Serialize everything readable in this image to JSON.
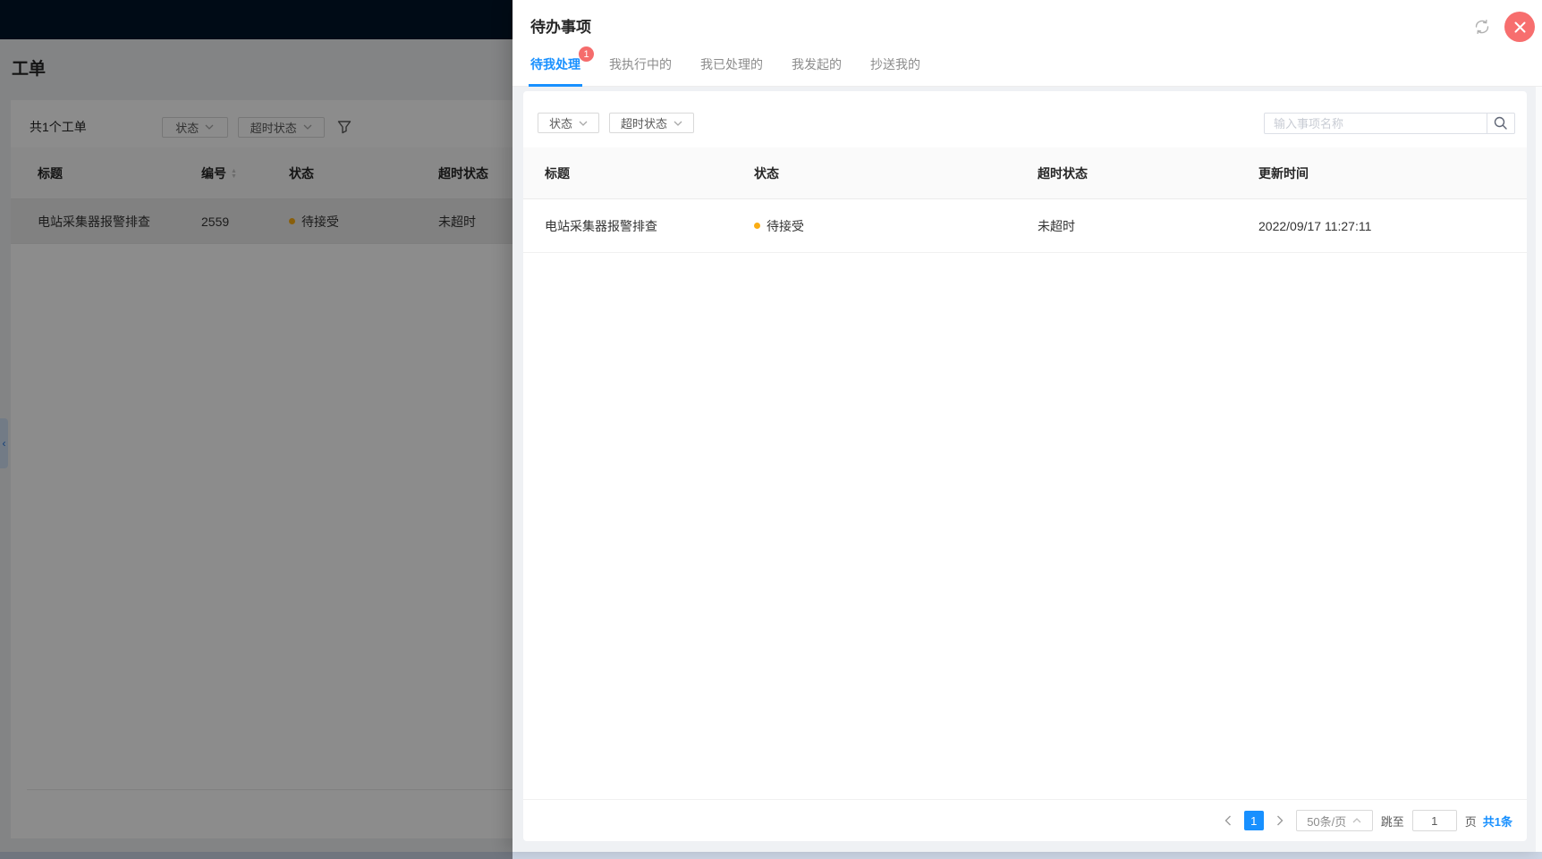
{
  "colors": {
    "accent": "#1890ff",
    "badge": "#f56c6c",
    "close_button": "#f76e6e",
    "status_dot": "#faad14",
    "topbar": "#001529"
  },
  "background": {
    "page_title": "工单",
    "toolbar": {
      "count": "共1个工单",
      "status_filter": "状态",
      "timeout_filter": "超时状态"
    },
    "table": {
      "headers": [
        "标题",
        "编号",
        "状态",
        "超时状态"
      ],
      "row": {
        "title": "电站采集器报警排查",
        "number": "2559",
        "status": "待接受",
        "timeout": "未超时"
      }
    }
  },
  "drawer": {
    "title": "待办事项",
    "tabs": [
      {
        "label": "待我处理",
        "badge": "1"
      },
      {
        "label": "我执行中的"
      },
      {
        "label": "我已处理的"
      },
      {
        "label": "我发起的"
      },
      {
        "label": "抄送我的"
      }
    ],
    "filters": {
      "status": "状态",
      "timeout": "超时状态"
    },
    "search_placeholder": "输入事项名称",
    "table": {
      "headers": [
        "标题",
        "状态",
        "超时状态",
        "更新时间"
      ],
      "row": {
        "title": "电站采集器报警排查",
        "status": "待接受",
        "timeout": "未超时",
        "updated_at": "2022/09/17 11:27:11"
      }
    },
    "pagination": {
      "current_page": "1",
      "page_size": "50条/页",
      "jump_label": "跳至",
      "jump_value": "1",
      "page_unit": "页",
      "total": "共1条"
    }
  }
}
